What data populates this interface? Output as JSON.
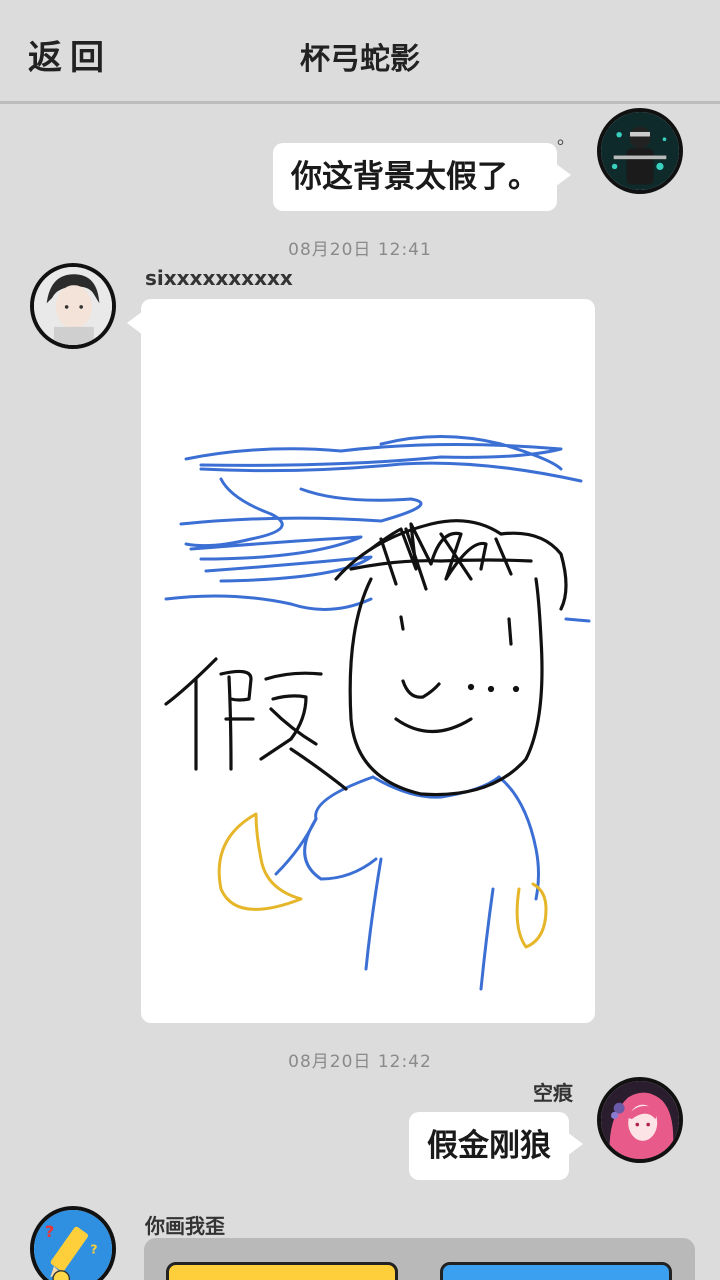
{
  "header": {
    "back_label": "返回",
    "title": "杯弓蛇影"
  },
  "messages": [
    {
      "text": "你这背景太假了。",
      "side": "right",
      "tag": "。"
    },
    {
      "timestamp": "08月20日  12:41",
      "sender": "sixxxxxxxxxx",
      "side": "left",
      "content": "drawing",
      "drawing_text": "假"
    },
    {
      "timestamp": "08月20日  12:42",
      "sender": "空痕",
      "text": "假金刚狼",
      "side": "right"
    },
    {
      "sender": "你画我歪",
      "side": "left",
      "content": "game-card"
    }
  ],
  "colors": {
    "background": "#dcdcdc",
    "bubble": "#ffffff",
    "stroke_blue": "#3b6fd4",
    "stroke_yellow": "#e6b62a",
    "game_yellow": "#ffcf3b",
    "game_blue": "#3aa0ef"
  }
}
